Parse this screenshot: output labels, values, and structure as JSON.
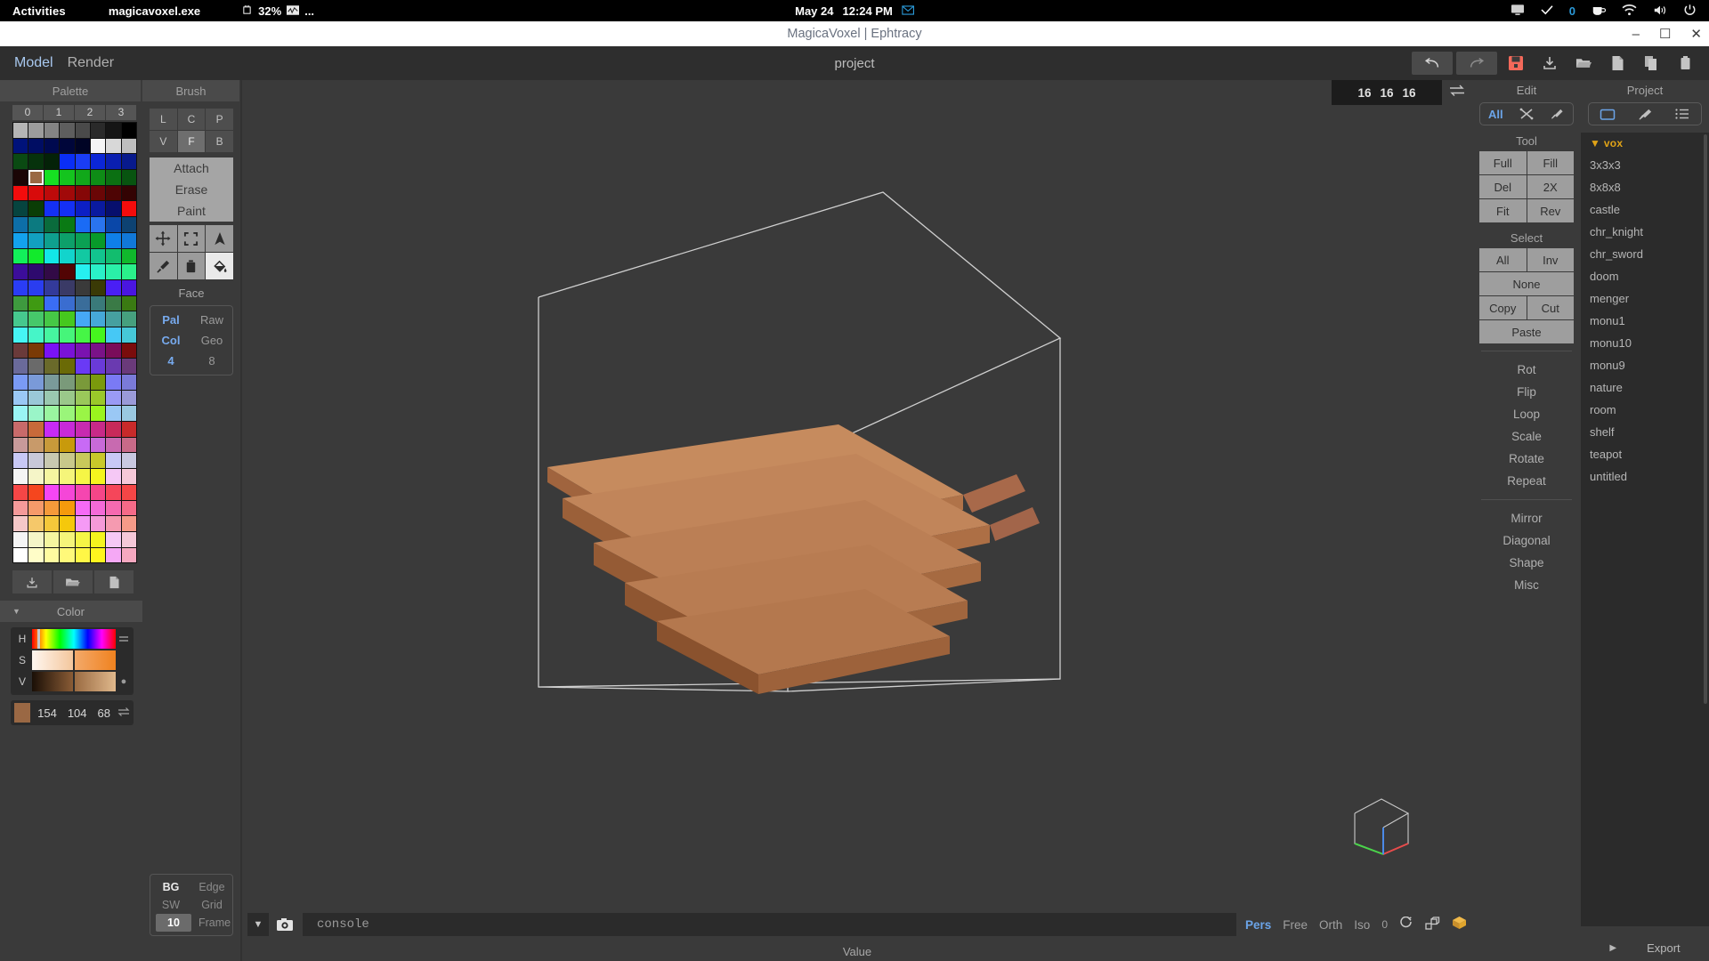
{
  "os_bar": {
    "activities": "Activities",
    "app_name": "magicavoxel.exe",
    "cpu_icon": "cpu-icon",
    "cpu_usage": "32%",
    "graph_icon": "graph-icon",
    "ellipsis": "...",
    "date": "May 24",
    "time": "12:24 PM",
    "mail_icon": "mail-icon",
    "tray": {
      "display_icon": "display-icon",
      "check_icon": "check-icon",
      "check_count": "0",
      "coffee_icon": "coffee-icon",
      "wifi_icon": "wifi-icon",
      "volume_icon": "volume-icon",
      "power_icon": "power-icon"
    }
  },
  "title_bar": {
    "title": "MagicaVoxel | Ephtracy",
    "minimize": "–",
    "maximize": "☐",
    "close": "✕"
  },
  "menu_bar": {
    "items": [
      {
        "label": "Model",
        "active": true
      },
      {
        "label": "Render",
        "active": false
      }
    ],
    "project_name": "project",
    "tools": [
      {
        "name": "undo-button",
        "glyph": "↶"
      },
      {
        "name": "redo-button",
        "glyph": "↷"
      },
      {
        "name": "save-button",
        "glyph": "💾"
      },
      {
        "name": "import-button",
        "glyph": "⤓"
      },
      {
        "name": "open-folder-button",
        "glyph": "📁"
      },
      {
        "name": "new-file-button",
        "glyph": "🗋"
      },
      {
        "name": "copy-button",
        "glyph": "🗐"
      },
      {
        "name": "delete-button",
        "glyph": "🗑"
      }
    ]
  },
  "palette_panel": {
    "tab_label": "Palette",
    "column_numbers": [
      "0",
      "1",
      "2",
      "3"
    ],
    "selected_index": 25,
    "colors": [
      "#b5b5b5",
      "#9c9c9c",
      "#848484",
      "#5e5e5e",
      "#4a4a4a",
      "#2a2a2a",
      "#151515",
      "#000000",
      "#00127a",
      "#000d63",
      "#00094f",
      "#00063a",
      "#000425",
      "#f5f5f5",
      "#d8d8d8",
      "#bfbfbf",
      "#0a4a12",
      "#06320c",
      "#042208",
      "#0a2ef5",
      "#1a3df5",
      "#0b26d6",
      "#0a1fb0",
      "#081a8c",
      "#1a0505",
      "#9a6844",
      "#16e022",
      "#14c41e",
      "#11a81a",
      "#0e8c16",
      "#0b7012",
      "#085410",
      "#f40c0c",
      "#d80b0b",
      "#bd0a0a",
      "#a10909",
      "#850707",
      "#6a0606",
      "#4e0404",
      "#330303",
      "#06443f",
      "#0a3d06",
      "#1430f5",
      "#1430f5",
      "#0c1fc4",
      "#0a1a9f",
      "#070f6d",
      "#f40c0c",
      "#0d6ea8",
      "#0c7a80",
      "#0a6b3c",
      "#0a7a14",
      "#1a6bf5",
      "#2a74ee",
      "#0a47a8",
      "#0d4272",
      "#13a2ee",
      "#12a0c0",
      "#0fa08e",
      "#0da06a",
      "#0ba053",
      "#089a2a",
      "#0f7fe8",
      "#1178d8",
      "#12f05a",
      "#12ea2c",
      "#12e7e7",
      "#12d4cc",
      "#12c9a2",
      "#12c58e",
      "#12bd6e",
      "#10b82c",
      "#3c0d9a",
      "#2e0a6e",
      "#320a46",
      "#520404",
      "#26f0f0",
      "#2af0c8",
      "#2af0a8",
      "#2af08a",
      "#2a3df5",
      "#2a3df0",
      "#333a9a",
      "#3a3a66",
      "#3a3a3a",
      "#3a3a06",
      "#4a1ff5",
      "#4a16e0",
      "#3e9a3e",
      "#3f9a12",
      "#3a6df5",
      "#3a6dd0",
      "#3a6d9a",
      "#3a7a7a",
      "#3a7a46",
      "#3a7a12",
      "#46c88e",
      "#46c86a",
      "#46c846",
      "#46c81e",
      "#46a8f5",
      "#46a8d8",
      "#46a0a0",
      "#46a07e",
      "#46f5f5",
      "#46f5c8",
      "#46f5a0",
      "#46f57a",
      "#46f546",
      "#46f51e",
      "#46c8f5",
      "#46c8d8",
      "#6a3a3a",
      "#7a3a06",
      "#7a12f5",
      "#7a12d8",
      "#7a12b0",
      "#7a1288",
      "#7a0c5a",
      "#7a0c0c",
      "#6a6a9a",
      "#6a6a6a",
      "#6a6a2a",
      "#6a6a06",
      "#6a3af5",
      "#6a3ad8",
      "#6a3ab0",
      "#6a3a7a",
      "#7a9af5",
      "#7a9ad8",
      "#7a9a9a",
      "#7a9a7a",
      "#7a9a3a",
      "#7a9a0c",
      "#7a7af5",
      "#7a7ad8",
      "#9ac8f5",
      "#9ac8d8",
      "#9ac8b0",
      "#9ac88a",
      "#9ac85a",
      "#9ac82a",
      "#9a9af5",
      "#9a9ad8",
      "#9af5f5",
      "#9af5c8",
      "#9af5a0",
      "#9af57a",
      "#9af546",
      "#9af51e",
      "#9ac8f5",
      "#9ac8e0",
      "#c86a6a",
      "#c86a3a",
      "#c82af5",
      "#c82ad8",
      "#c82ab0",
      "#c82a88",
      "#c82a5a",
      "#c82a2a",
      "#c89a9a",
      "#c89a6a",
      "#c89a3a",
      "#c89a0c",
      "#c86af5",
      "#c86ad8",
      "#c86ab0",
      "#c86a88",
      "#c8c8f5",
      "#c8c8d8",
      "#c8c8b0",
      "#c8c88a",
      "#c8c85a",
      "#c8c82a",
      "#c8c8f5",
      "#c8c8e0",
      "#f5f5f5",
      "#f5f5c8",
      "#f5f5a0",
      "#f5f57a",
      "#f5f546",
      "#f5f51e",
      "#f5c8f5",
      "#f5c8d8",
      "#f54646",
      "#f5461e",
      "#f546f5",
      "#f546d8",
      "#f546b0",
      "#f54688",
      "#f5465a",
      "#f54646",
      "#f59a9a",
      "#f59a6a",
      "#f59a3a",
      "#f59a0c",
      "#f56af5",
      "#f56ad8",
      "#f56ab0",
      "#f56a88",
      "#f5c8c8",
      "#f5c86a",
      "#f5c83a",
      "#f5c80c",
      "#f59af5",
      "#f59ad8",
      "#f59ab0",
      "#f59a88",
      "#f5f5f5",
      "#f5f5c8",
      "#f5f5a0",
      "#f5f57a",
      "#f5f546",
      "#f5f51e",
      "#f5c8f5",
      "#f5c8d8",
      "#ffffff",
      "#fffdc8",
      "#fffba0",
      "#fff97a",
      "#fff746",
      "#fff51e",
      "#f5a8f5",
      "#f5a8c0"
    ],
    "footer_buttons": [
      {
        "name": "palette-save-button",
        "glyph": "⤓"
      },
      {
        "name": "palette-open-button",
        "glyph": "📁"
      },
      {
        "name": "palette-new-button",
        "glyph": "🗋"
      }
    ]
  },
  "color_panel": {
    "caret": "▼",
    "title": "Color",
    "rows": [
      {
        "key": "H",
        "tail_icon": "menu-lines-icon"
      },
      {
        "key": "S",
        "tail_icon": ""
      },
      {
        "key": "V",
        "tail_icon": "dot-icon"
      }
    ],
    "current_color": "#9a6844",
    "rgb": {
      "r": "154",
      "g": "104",
      "b": "68"
    },
    "swap_icon": "swap-icon"
  },
  "brush_panel": {
    "tab_label": "Brush",
    "mode_keys_row1": [
      {
        "label": "L",
        "active": false
      },
      {
        "label": "C",
        "active": false
      },
      {
        "label": "P",
        "active": false
      }
    ],
    "mode_keys_row2": [
      {
        "label": "V",
        "active": false
      },
      {
        "label": "F",
        "active": true
      },
      {
        "label": "B",
        "active": false
      }
    ],
    "actions": [
      "Attach",
      "Erase",
      "Paint"
    ],
    "tools": [
      {
        "name": "move-tool-icon",
        "glyph": "✥",
        "active": false
      },
      {
        "name": "select-box-tool-icon",
        "glyph": "⬚",
        "active": false
      },
      {
        "name": "cursor-tool-icon",
        "glyph": "▲",
        "active": false
      },
      {
        "name": "eyedropper-tool-icon",
        "glyph": "✐",
        "active": false
      },
      {
        "name": "trash-tool-icon",
        "glyph": "🗑",
        "active": false
      },
      {
        "name": "bucket-fill-tool-icon",
        "glyph": "☂",
        "active": true
      }
    ],
    "face_label": "Face",
    "face_options": [
      {
        "left": "Pal",
        "left_hl": true,
        "right": "Raw",
        "right_hl": false
      },
      {
        "left": "Col",
        "left_hl": true,
        "right": "Geo",
        "right_hl": false
      },
      {
        "left": "4",
        "left_hl": true,
        "right": "8",
        "right_hl": false
      }
    ],
    "display_options": [
      {
        "left": "BG",
        "left_strong": true,
        "right": "Edge",
        "right_strong": false
      },
      {
        "left": "SW",
        "left_strong": false,
        "right": "Grid",
        "right_strong": false
      },
      {
        "left": "10",
        "left_chip": true,
        "right": "Frame",
        "right_strong": false
      }
    ]
  },
  "viewport": {
    "size": {
      "x": "16",
      "y": "16",
      "z": "16"
    },
    "swap_icon": "swap-axes-icon",
    "gizmo_name": "view-orientation-gizmo"
  },
  "edit_panel": {
    "title": "Edit",
    "segment": [
      {
        "label": "All",
        "name": "edit-mode-all",
        "hl": true
      },
      {
        "label": "✕",
        "name": "edit-mode-transform",
        "hl": false
      },
      {
        "label": "⚒",
        "name": "edit-mode-settings",
        "hl": false
      }
    ],
    "tool_label": "Tool",
    "tool_buttons": [
      "Full",
      "Fill",
      "Del",
      "2X",
      "Fit",
      "Rev"
    ],
    "select_label": "Select",
    "select_buttons": [
      "All",
      "Inv",
      "None",
      "Copy",
      "Cut",
      "Paste"
    ],
    "links_group1": [
      "Rot",
      "Flip",
      "Loop",
      "Scale",
      "Rotate",
      "Repeat"
    ],
    "links_group2": [
      "Mirror",
      "Diagonal",
      "Shape",
      "Misc"
    ]
  },
  "project_panel": {
    "title": "Project",
    "segment": [
      {
        "name": "project-folder-icon",
        "glyph": "🗀"
      },
      {
        "name": "project-brush-icon",
        "glyph": "✒"
      },
      {
        "name": "project-list-icon",
        "glyph": "☰"
      }
    ],
    "root_label": "vox",
    "root_caret": "▼",
    "items": [
      "3x3x3",
      "8x8x8",
      "castle",
      "chr_knight",
      "chr_sword",
      "doom",
      "menger",
      "monu1",
      "monu10",
      "monu9",
      "nature",
      "room",
      "shelf",
      "teapot",
      "untitled"
    ],
    "footer": {
      "arrow": "▶",
      "export_label": "Export"
    }
  },
  "bottom_bar": {
    "dropdown_icon": "chevron-down-icon",
    "camera_icon": "camera-icon",
    "console_value": "console",
    "camera_modes": [
      {
        "label": "Pers",
        "active": true
      },
      {
        "label": "Free",
        "active": false
      },
      {
        "label": "Orth",
        "active": false
      },
      {
        "label": "Iso",
        "active": false
      }
    ],
    "frame_value": "0",
    "rotate_icon": "rotate-icon",
    "steps-icon": "steps-icon",
    "cube_icon": "cube-icon",
    "value_label": "Value"
  },
  "colors": {
    "accent_blue": "#6ba4e8",
    "accent_orange": "#e0a317",
    "save_red": "#f4695a",
    "panel_bg": "#3a3a3a",
    "dark_bg": "#2b2b2b"
  }
}
